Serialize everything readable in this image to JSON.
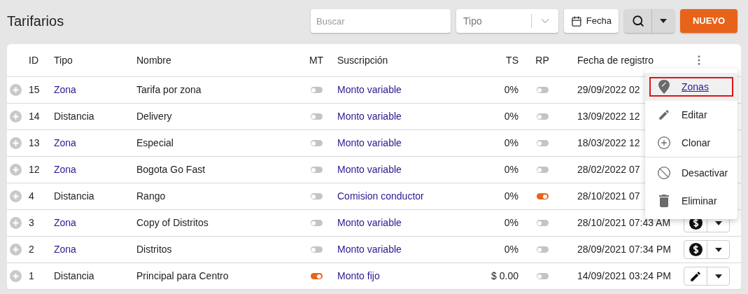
{
  "page": {
    "title": "Tarifarios"
  },
  "toolbar": {
    "search": {
      "placeholder": "Buscar"
    },
    "type_select": {
      "placeholder": "Tipo"
    },
    "date_button": "Fecha",
    "new_button": "NUEVO"
  },
  "table": {
    "columns": [
      "ID",
      "Tipo",
      "Nombre",
      "MT",
      "Suscripción",
      "TS",
      "RP",
      "Fecha de registro"
    ],
    "rows": [
      {
        "id": "15",
        "tipo": "Zona",
        "tipo_link": true,
        "nombre": "Tarifa por zona",
        "mt": false,
        "suscripcion": "Monto variable",
        "ts": "0%",
        "rp": false,
        "fecha": "29/09/2022 02"
      },
      {
        "id": "14",
        "tipo": "Distancia",
        "tipo_link": false,
        "nombre": "Delivery",
        "mt": false,
        "suscripcion": "Monto variable",
        "ts": "0%",
        "rp": false,
        "fecha": "13/09/2022 12"
      },
      {
        "id": "13",
        "tipo": "Zona",
        "tipo_link": true,
        "nombre": "Especial",
        "mt": false,
        "suscripcion": "Monto variable",
        "ts": "0%",
        "rp": false,
        "fecha": "18/03/2022 12"
      },
      {
        "id": "12",
        "tipo": "Zona",
        "tipo_link": true,
        "nombre": "Bogota Go Fast",
        "mt": false,
        "suscripcion": "Monto variable",
        "ts": "0%",
        "rp": false,
        "fecha": "28/02/2022 07"
      },
      {
        "id": "4",
        "tipo": "Distancia",
        "tipo_link": false,
        "nombre": "Rango",
        "mt": false,
        "suscripcion": "Comision conductor",
        "ts": "0%",
        "rp": true,
        "fecha": "28/10/2021 07"
      },
      {
        "id": "3",
        "tipo": "Zona",
        "tipo_link": true,
        "nombre": "Copy of Distritos",
        "mt": false,
        "suscripcion": "Monto variable",
        "ts": "0%",
        "rp": false,
        "fecha": "28/10/2021 07:43 AM",
        "action": {
          "kind": "dollar"
        }
      },
      {
        "id": "2",
        "tipo": "Zona",
        "tipo_link": true,
        "nombre": "Distritos",
        "mt": false,
        "suscripcion": "Monto variable",
        "ts": "0%",
        "rp": false,
        "fecha": "28/09/2021 07:34 PM",
        "action": {
          "kind": "dollar"
        }
      },
      {
        "id": "1",
        "tipo": "Distancia",
        "tipo_link": false,
        "nombre": "Principal para Centro",
        "mt": true,
        "suscripcion": "Monto fijo",
        "ts": "$ 0.00",
        "rp": false,
        "fecha": "14/09/2021 03:24 PM",
        "action": {
          "kind": "pencil"
        }
      }
    ]
  },
  "menu": {
    "groups": [
      [
        {
          "label": "Zonas",
          "kind": "pin",
          "selected": true
        },
        {
          "label": "Editar",
          "kind": "pencil",
          "selected": false
        },
        {
          "label": "Clonar",
          "kind": "clone",
          "selected": false
        }
      ],
      [
        {
          "label": "Desactivar",
          "kind": "ban",
          "selected": false
        },
        {
          "label": "Eliminar",
          "kind": "trash",
          "selected": false
        }
      ]
    ]
  }
}
